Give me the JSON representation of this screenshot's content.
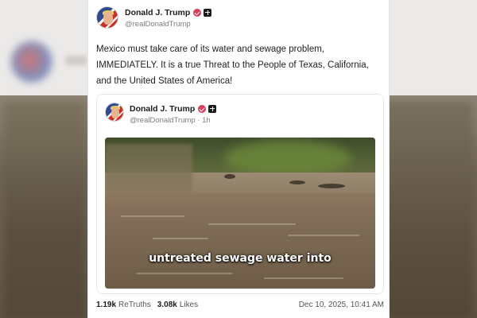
{
  "post": {
    "author_name": "Donald J. Trump",
    "author_handle": "@realDonaldTrump",
    "text": "Mexico must take care of its water and sewage problem, IMMEDIATELY. It is a true Threat to the People of Texas, California, and the United States of America!"
  },
  "quoted_post": {
    "author_name": "Donald J. Trump",
    "author_handle": "@realDonaldTrump · 1h",
    "video_caption": "untreated sewage water into"
  },
  "stats": {
    "retruths_count": "1.19k",
    "retruths_label": "ReTruths",
    "likes_count": "3.08k",
    "likes_label": "Likes",
    "date": "Dec 10, 2025, 10:41 AM"
  },
  "colors": {
    "verified_badge": "#d9405d",
    "text": "#222222",
    "muted": "#7d7d7d"
  },
  "icons": [
    "verified-badge-icon",
    "plus-badge-icon"
  ]
}
